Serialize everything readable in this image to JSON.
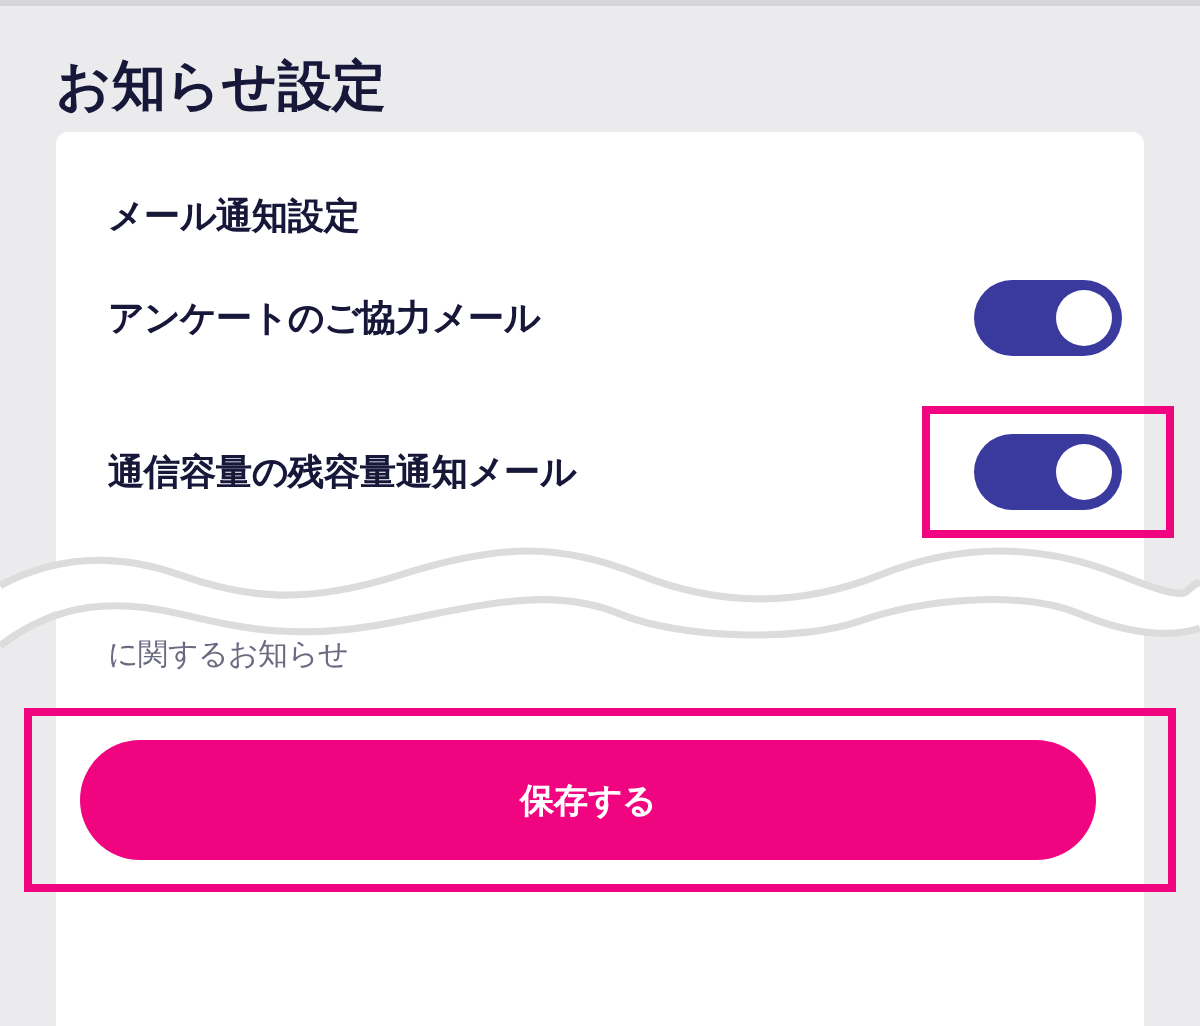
{
  "page_title": "お知らせ設定",
  "section_label": "メール通知設定",
  "settings": [
    {
      "label": "アンケートのご協力メール",
      "on": true,
      "highlighted": false
    },
    {
      "label": "通信容量の残容量通知メール",
      "on": true,
      "highlighted": true
    }
  ],
  "partial_text": "に関するお知らせ",
  "save_button": {
    "label": "保存する",
    "highlighted": true
  }
}
